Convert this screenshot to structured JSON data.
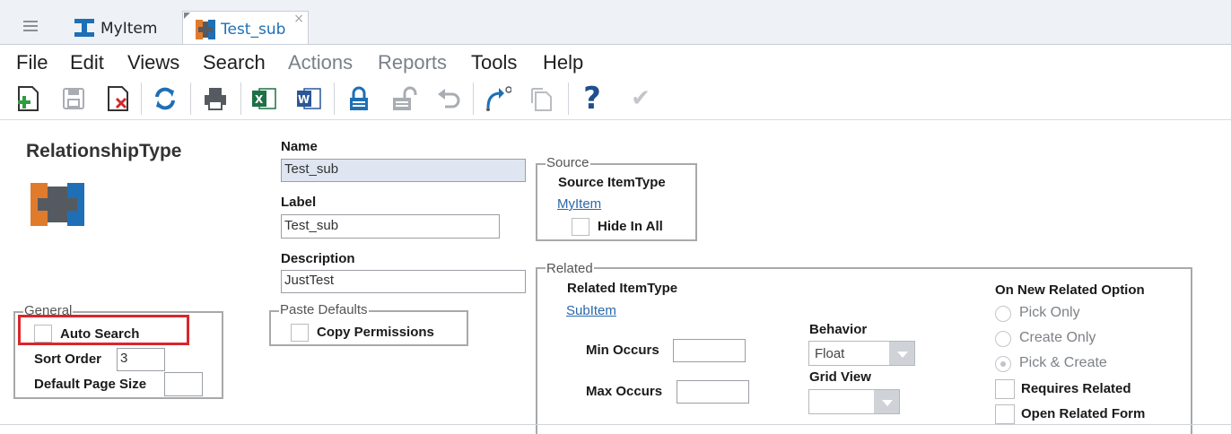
{
  "tabs": [
    {
      "label": "MyItem"
    },
    {
      "label": "Test_sub",
      "close": "×"
    }
  ],
  "menu": {
    "file": "File",
    "edit": "Edit",
    "views": "Views",
    "search": "Search",
    "actions": "Actions",
    "reports": "Reports",
    "tools": "Tools",
    "help": "Help"
  },
  "toolbar_icons": [
    "new-icon",
    "save-icon",
    "delete-icon",
    "refresh-icon",
    "print-icon",
    "excel-icon",
    "word-icon",
    "lock-icon",
    "unlock-icon",
    "undo-icon",
    "promote-icon",
    "duplicate-icon",
    "help-icon",
    "done-icon"
  ],
  "toolbar": {
    "help_glyph": "?",
    "check_glyph": "✔"
  },
  "colors": {
    "accent": "#1e6fb5",
    "orange": "#e07b2c",
    "dark": "#555a60",
    "highlight_box": "#d9262c"
  },
  "page": {
    "title": "RelationshipType"
  },
  "name": {
    "label": "Name",
    "value": "Test_sub"
  },
  "label_field": {
    "label": "Label",
    "value": "Test_sub"
  },
  "description": {
    "label": "Description",
    "value": "JustTest"
  },
  "paste_defaults": {
    "legend": "Paste Defaults",
    "copy_permissions": "Copy Permissions"
  },
  "general": {
    "legend": "General",
    "auto_search": "Auto Search",
    "sort_order_label": "Sort Order",
    "sort_order_value": "3",
    "default_page_size_label": "Default Page Size",
    "default_page_size_value": ""
  },
  "source": {
    "legend": "Source",
    "item_type_label": "Source ItemType",
    "item_type_link": "MyItem",
    "hide_in_all": "Hide In All"
  },
  "related": {
    "legend": "Related",
    "item_type_label": "Related ItemType",
    "item_type_link": "SubItem",
    "min_occurs": "Min Occurs",
    "max_occurs": "Max Occurs",
    "behavior_label": "Behavior",
    "behavior_value": "Float",
    "grid_view_label": "Grid View",
    "grid_view_value": "",
    "on_new_label": "On New Related Option",
    "options": [
      "Pick Only",
      "Create Only",
      "Pick & Create"
    ],
    "selected_option": "Pick & Create",
    "requires_related": "Requires Related",
    "open_related_form": "Open Related Form"
  }
}
